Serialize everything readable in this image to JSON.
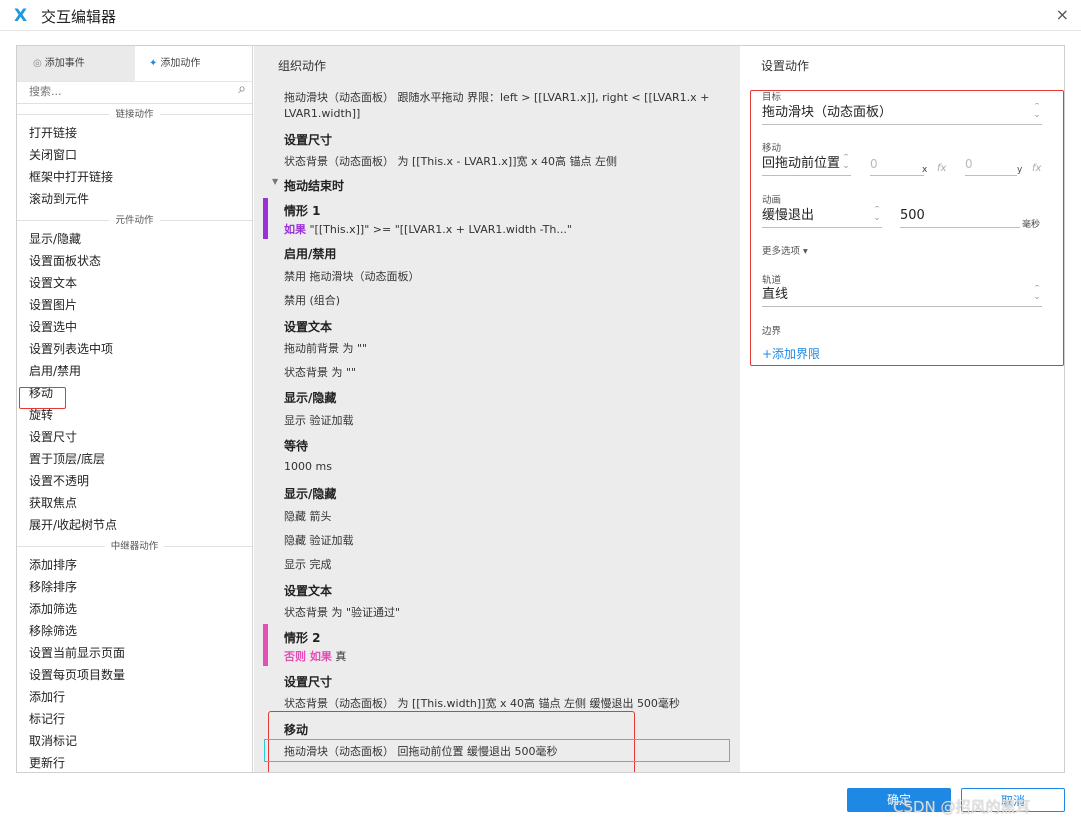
{
  "window": {
    "title": "交互编辑器",
    "logo": "X",
    "close": "×"
  },
  "left": {
    "tab_events": "添加事件",
    "tab_actions": "添加动作",
    "search_placeholder": "搜索...",
    "groups": [
      {
        "title": "链接动作",
        "items": [
          "打开链接",
          "关闭窗口",
          "框架中打开链接",
          "滚动到元件"
        ]
      },
      {
        "title": "元件动作",
        "items": [
          "显示/隐藏",
          "设置面板状态",
          "设置文本",
          "设置图片",
          "设置选中",
          "设置列表选中项",
          "启用/禁用",
          "移动",
          "旋转",
          "设置尺寸",
          "置于顶层/底层",
          "设置不透明",
          "获取焦点",
          "展开/收起树节点"
        ]
      },
      {
        "title": "中继器动作",
        "items": [
          "添加排序",
          "移除排序",
          "添加筛选",
          "移除筛选",
          "设置当前显示页面",
          "设置每页项目数量",
          "添加行",
          "标记行",
          "取消标记",
          "更新行"
        ]
      }
    ]
  },
  "middle": {
    "header": "组织动作",
    "line1a": "拖动滑块（动态面板） 跟随水平拖动 界限：left > [[LVAR1.x]], right < [[LVAR1.x +",
    "line1b": "LVAR1.width]]",
    "set_size_1": "设置尺寸",
    "set_size_1_detail": "状态背景（动态面板） 为 [[This.x - LVAR1.x]]宽 x 40高 锚点 左侧",
    "drag_end": "拖动结束时",
    "case1_title": "情形 1",
    "case1_if": "如果",
    "case1_cond": " \"[[This.x]]\" >= \"[[LVAR1.x + LVAR1.width -Th...\"",
    "enable_disable": "启用/禁用",
    "disable_1": "禁用 拖动滑块（动态面板）",
    "disable_2": "禁用 (组合)",
    "set_text_1": "设置文本",
    "set_text_1a": "拖动前背景 为 \"\"",
    "set_text_1b": "状态背景 为 \"\"",
    "show_hide_1": "显示/隐藏",
    "show_verify": "显示 验证加载",
    "wait": "等待",
    "wait_ms": "1000 ms",
    "show_hide_2": "显示/隐藏",
    "hide_arrow": "隐藏 箭头",
    "hide_verify": "隐藏 验证加载",
    "show_done": "显示 完成",
    "set_text_2": "设置文本",
    "set_text_2a": "状态背景 为 \"验证通过\"",
    "case2_title": "情形 2",
    "case2_else": "否则 如果",
    "case2_true": " 真",
    "set_size_2": "设置尺寸",
    "set_size_2_detail": "状态背景（动态面板） 为 [[This.width]]宽 x 40高 锚点 左侧 缓慢退出 500毫秒",
    "move": "移动",
    "move_detail": "拖动滑块（动态面板） 回拖动前位置 缓慢退出 500毫秒"
  },
  "right": {
    "header": "设置动作",
    "target_label": "目标",
    "target_value": "拖动滑块（动态面板）",
    "move_label": "移动",
    "move_value": "回拖动前位置",
    "x_value": "0",
    "x_unit": "x",
    "y_value": "0",
    "y_unit": "y",
    "fx": "fx",
    "anim_label": "动画",
    "anim_value": "缓慢退出",
    "anim_ms": "500",
    "ms_unit": "毫秒",
    "more_options": "更多选项 ▾",
    "track_label": "轨道",
    "track_value": "直线",
    "bound_label": "边界",
    "add_bound": "+添加界限"
  },
  "footer": {
    "ok": "确定",
    "cancel": "取消",
    "watermark": "CSDN @招风的黑耳"
  },
  "colors": {
    "accent": "#1e88e5",
    "case1": "#9b30d9",
    "case2": "#e54fb5",
    "highlight_red": "#e53935",
    "highlight_cyan": "#2ec9d9"
  }
}
